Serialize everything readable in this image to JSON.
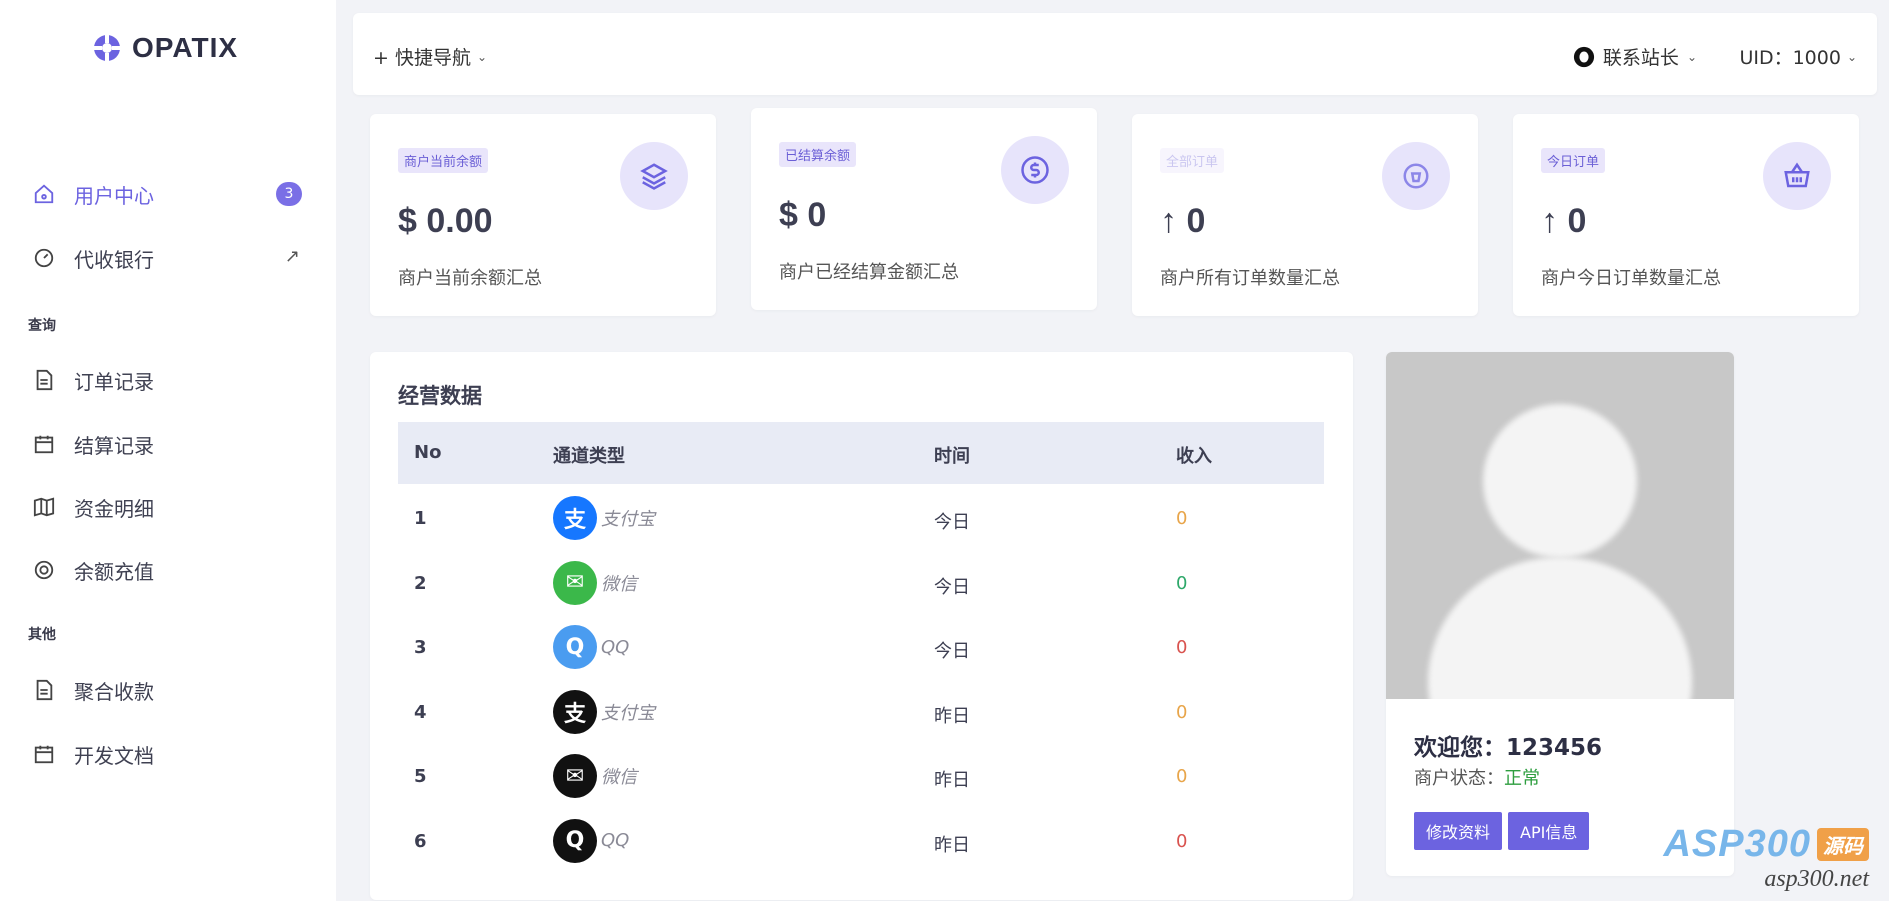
{
  "brand": {
    "name": "OPATIX",
    "accent": "#6c63e0"
  },
  "sidebar": {
    "items": [
      {
        "label": "用户中心",
        "icon": "home-icon",
        "badge": "3",
        "active": true
      },
      {
        "label": "代收银行",
        "icon": "dashboard-icon",
        "marker": "↗"
      }
    ],
    "sections": [
      {
        "title": "查询",
        "items": [
          {
            "label": "订单记录",
            "icon": "document-icon"
          },
          {
            "label": "结算记录",
            "icon": "calendar-icon"
          },
          {
            "label": "资金明细",
            "icon": "map-icon"
          },
          {
            "label": "余额充值",
            "icon": "aperture-icon"
          }
        ]
      },
      {
        "title": "其他",
        "items": [
          {
            "label": "聚合收款",
            "icon": "document-icon"
          },
          {
            "label": "开发文档",
            "icon": "calendar-icon"
          }
        ]
      }
    ]
  },
  "topbar": {
    "quick_nav": "+ 快捷导航",
    "contact": "联系站长",
    "uid": "UID：1000"
  },
  "stats": [
    {
      "tag": "商户当前余额",
      "value": "$ 0.00",
      "desc": "商户当前余额汇总",
      "icon": "layers-icon"
    },
    {
      "tag": "已结算余额",
      "value": "$ 0",
      "desc": "商户已经结算金额汇总",
      "icon": "dollar-circle-icon"
    },
    {
      "tag": "全部订单",
      "value": "↑ 0",
      "desc": "商户所有订单数量汇总",
      "icon": "bag-icon"
    },
    {
      "tag": "今日订单",
      "value": "↑ 0",
      "desc": "商户今日订单数量汇总",
      "icon": "basket-icon"
    }
  ],
  "business": {
    "title": "经营数据",
    "columns": [
      "No",
      "通道类型",
      "时间",
      "收入"
    ],
    "rows": [
      {
        "no": "1",
        "channel": "支付宝",
        "time": "今日",
        "income": "0",
        "icon_bg": "#1677ff",
        "icon_glyph": "支",
        "income_color": "#e8a54a"
      },
      {
        "no": "2",
        "channel": "微信",
        "time": "今日",
        "income": "0",
        "icon_bg": "#3bb84a",
        "icon_glyph": "✉",
        "income_color": "#2ea86a"
      },
      {
        "no": "3",
        "channel": "QQ",
        "time": "今日",
        "income": "0",
        "icon_bg": "#4a9cf0",
        "icon_glyph": "Q",
        "income_color": "#d9534f"
      },
      {
        "no": "4",
        "channel": "支付宝",
        "time": "昨日",
        "income": "0",
        "icon_bg": "#111111",
        "icon_glyph": "支",
        "income_color": "#e8a54a"
      },
      {
        "no": "5",
        "channel": "微信",
        "time": "昨日",
        "income": "0",
        "icon_bg": "#111111",
        "icon_glyph": "✉",
        "income_color": "#e8a54a"
      },
      {
        "no": "6",
        "channel": "QQ",
        "time": "昨日",
        "income": "0",
        "icon_bg": "#111111",
        "icon_glyph": "Q",
        "income_color": "#d9534f"
      }
    ]
  },
  "profile": {
    "welcome": "欢迎您：123456",
    "status_label": "商户状态：",
    "status_value": "正常",
    "edit_button": "修改资料",
    "api_button": "API信息"
  },
  "watermark": {
    "brand": "ASP300",
    "tag": "源码",
    "url": "asp300.net"
  }
}
